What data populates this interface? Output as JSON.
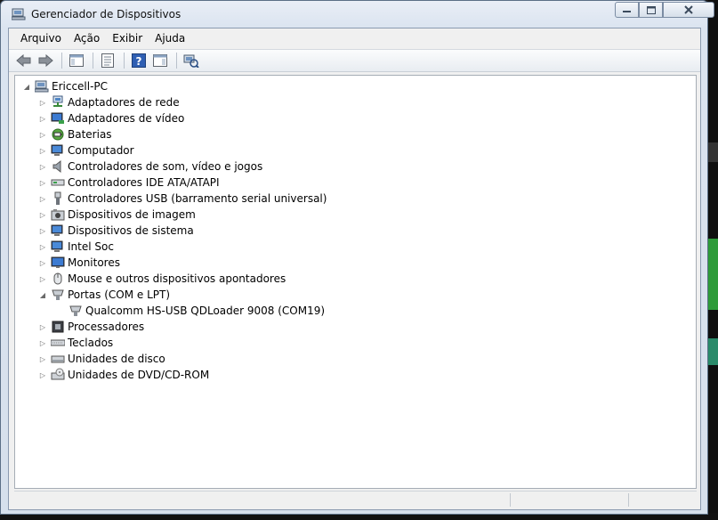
{
  "window": {
    "title": "Gerenciador de Dispositivos"
  },
  "caption": {
    "minimize": "▭",
    "maximize": "▣",
    "close": "✕"
  },
  "menu": [
    {
      "label": "Arquivo"
    },
    {
      "label": "Ação"
    },
    {
      "label": "Exibir"
    },
    {
      "label": "Ajuda"
    }
  ],
  "toolbar": {
    "buttons": [
      "back-icon",
      "forward-icon",
      "show-hide-console-tree-icon",
      "properties-icon",
      "help-icon",
      "action-pane-icon",
      "scan-hardware-icon"
    ]
  },
  "tree": {
    "root": {
      "label": "Ericcell-PC",
      "expanded": true
    },
    "categories": [
      {
        "label": "Adaptadores de rede",
        "icon": "network-adapter-icon"
      },
      {
        "label": "Adaptadores de vídeo",
        "icon": "display-adapter-icon"
      },
      {
        "label": "Baterias",
        "icon": "battery-icon"
      },
      {
        "label": "Computador",
        "icon": "computer-icon"
      },
      {
        "label": "Controladores de som, vídeo e jogos",
        "icon": "speaker-icon"
      },
      {
        "label": "Controladores IDE ATA/ATAPI",
        "icon": "ide-controller-icon"
      },
      {
        "label": "Controladores USB (barramento serial universal)",
        "icon": "usb-icon"
      },
      {
        "label": "Dispositivos de imagem",
        "icon": "camera-icon"
      },
      {
        "label": "Dispositivos de sistema",
        "icon": "system-device-icon"
      },
      {
        "label": "Intel Soc",
        "icon": "intel-soc-icon"
      },
      {
        "label": "Monitores",
        "icon": "monitor-icon"
      },
      {
        "label": "Mouse e outros dispositivos apontadores",
        "icon": "mouse-icon"
      },
      {
        "label": "Portas (COM e LPT)",
        "icon": "port-icon",
        "expanded": true,
        "children": [
          {
            "label": "Qualcomm HS-USB QDLoader 9008 (COM19)",
            "icon": "port-icon"
          }
        ]
      },
      {
        "label": "Processadores",
        "icon": "processor-icon"
      },
      {
        "label": "Teclados",
        "icon": "keyboard-icon"
      },
      {
        "label": "Unidades de disco",
        "icon": "disk-drive-icon"
      },
      {
        "label": "Unidades de DVD/CD-ROM",
        "icon": "dvd-drive-icon"
      }
    ]
  },
  "expander": {
    "collapsed": "▷",
    "expanded": "◢"
  }
}
